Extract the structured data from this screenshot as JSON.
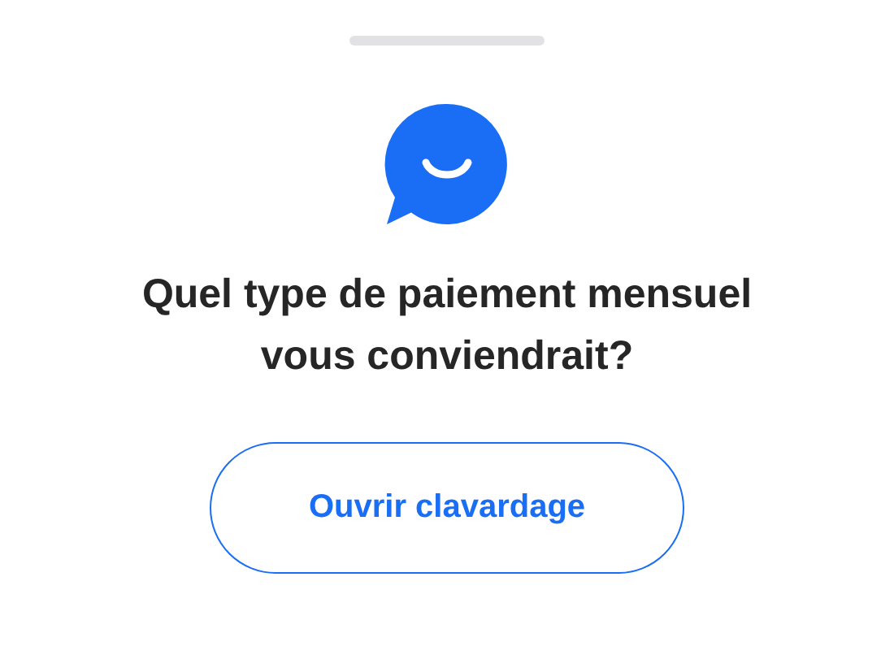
{
  "sheet": {
    "title": "Quel type de paiement mensuel vous conviendrait?",
    "button": "Ouvrir clavardage"
  }
}
